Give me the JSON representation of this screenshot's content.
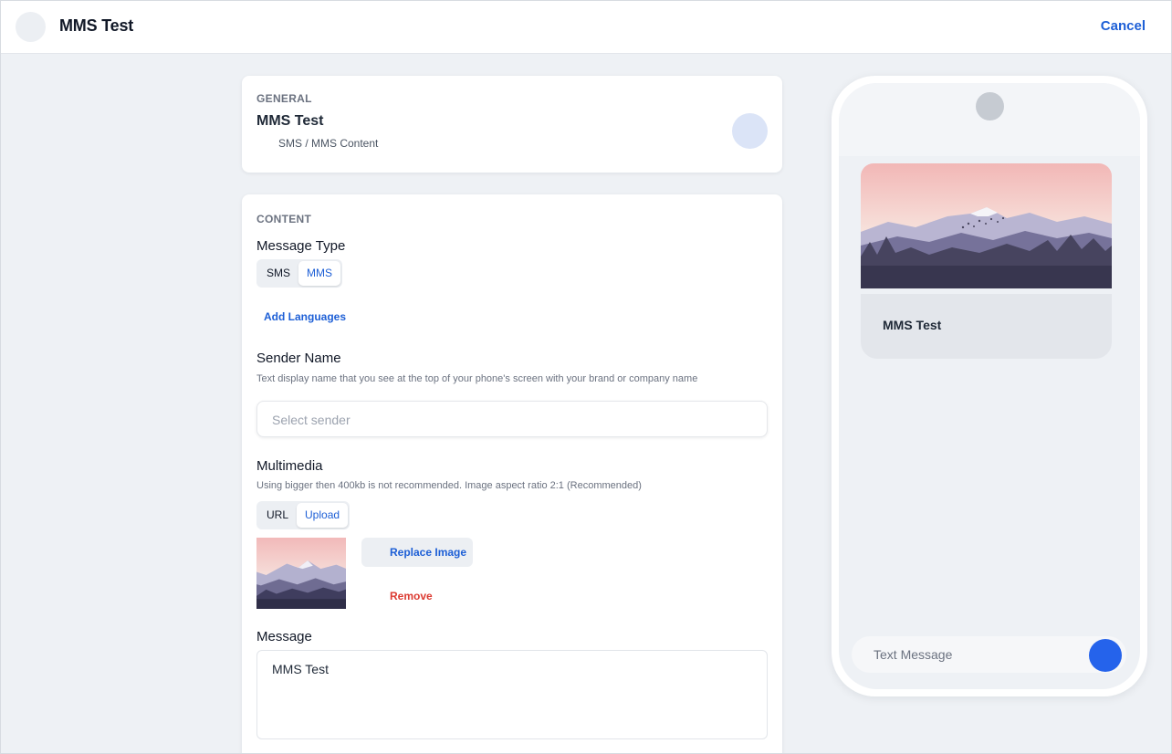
{
  "header": {
    "title": "MMS Test",
    "cancel_label": "Cancel"
  },
  "general": {
    "section_label": "GENERAL",
    "name": "MMS Test",
    "subtitle": "SMS / MMS Content"
  },
  "content": {
    "section_label": "CONTENT",
    "message_type": {
      "title": "Message Type",
      "options": [
        "SMS",
        "MMS"
      ],
      "selected": "MMS"
    },
    "add_languages_label": "Add Languages",
    "sender": {
      "title": "Sender Name",
      "hint": "Text display name that you see at the top of your phone's screen with your brand or company name",
      "placeholder": "Select sender"
    },
    "multimedia": {
      "title": "Multimedia",
      "hint": "Using bigger then 400kb is not recommended. Image aspect ratio 2:1 (Recommended)",
      "options": [
        "URL",
        "Upload"
      ],
      "selected": "Upload",
      "replace_label": "Replace Image",
      "remove_label": "Remove"
    },
    "message": {
      "title": "Message",
      "value": "MMS Test"
    }
  },
  "preview": {
    "bubble_text": "MMS Test",
    "input_placeholder": "Text Message"
  },
  "colors": {
    "accent": "#1d5fd6",
    "danger": "#dc3b32",
    "send_button": "#2563eb",
    "background": "#eef1f5"
  }
}
